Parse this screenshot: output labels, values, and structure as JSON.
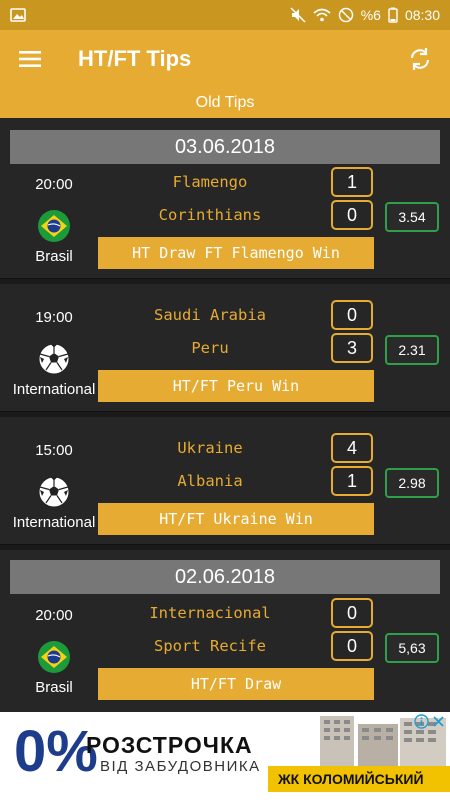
{
  "status_bar": {
    "battery": "%6",
    "time": "08:30"
  },
  "app_bar": {
    "title": "HT/FT Tips"
  },
  "sub_bar": {
    "label": "Old Tips"
  },
  "sections": [
    {
      "date": "03.06.2018"
    },
    {
      "date": "02.06.2018"
    }
  ],
  "matches": [
    {
      "time": "20:00",
      "country": "Brasil",
      "home": "Flamengo",
      "away": "Corinthians",
      "home_score": "1",
      "away_score": "0",
      "odds": "3.54",
      "tip": "HT Draw FT Flamengo Win"
    },
    {
      "time": "19:00",
      "country": "International",
      "home": "Saudi Arabia",
      "away": "Peru",
      "home_score": "0",
      "away_score": "3",
      "odds": "2.31",
      "tip": "HT/FT Peru Win"
    },
    {
      "time": "15:00",
      "country": "International",
      "home": "Ukraine",
      "away": "Albania",
      "home_score": "4",
      "away_score": "1",
      "odds": "2.98",
      "tip": "HT/FT Ukraine Win"
    },
    {
      "time": "20:00",
      "country": "Brasil",
      "home": "Internacional",
      "away": "Sport Recife",
      "home_score": "0",
      "away_score": "0",
      "odds": "5,63",
      "tip": "HT/FT Draw"
    }
  ],
  "ad": {
    "big": "0%",
    "line1": "РОЗСТРОЧКА",
    "line2": "ВІД ЗАБУДОВНИКА",
    "bar": "ЖК КОЛОМИЙСЬКИЙ"
  },
  "colors": {
    "accent": "#e6ab32",
    "odds_border": "#2fa04a",
    "date_header": "#777777"
  }
}
